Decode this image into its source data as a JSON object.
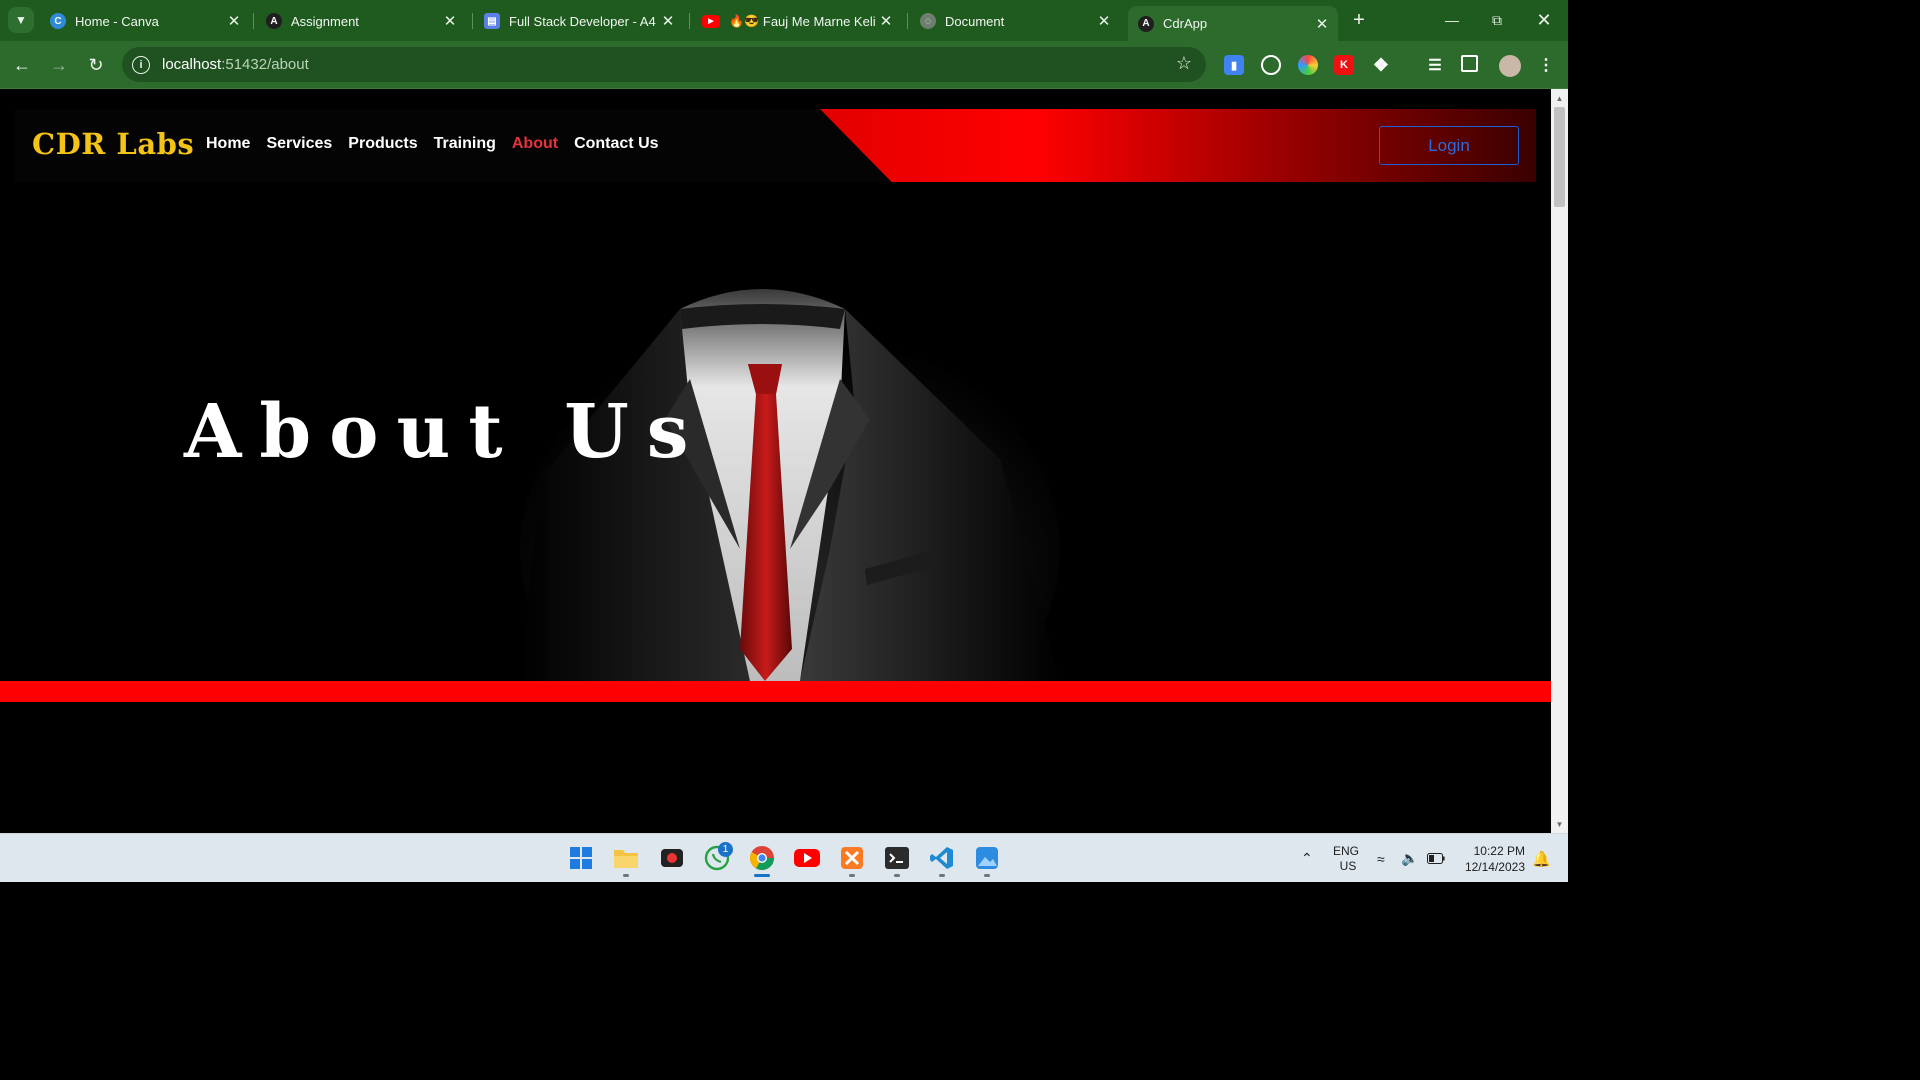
{
  "browser": {
    "tabs": [
      {
        "title": "Home - Canva",
        "icon": "canva-icon",
        "color": "#2f8bd8",
        "glyph": "C"
      },
      {
        "title": "Assignment",
        "icon": "angular-icon",
        "color": "#1f1f1f",
        "glyph": "A"
      },
      {
        "title": "Full Stack Developer - A4",
        "icon": "document-icon",
        "color": "#5b7fe6",
        "glyph": "▤"
      },
      {
        "title": "Fauj Me Marne Keliye",
        "icon": "youtube-icon",
        "color": "#ff0000",
        "glyph": "▶"
      },
      {
        "title": "Document",
        "icon": "globe-icon",
        "color": "#6f7f6f",
        "glyph": "◌"
      },
      {
        "title": "CdrApp",
        "icon": "angular-icon",
        "color": "#1f1f1f",
        "glyph": "A"
      }
    ],
    "url_host": "localhost",
    "url_path": ":51432/about"
  },
  "site": {
    "logo": "CDR Labs",
    "menu": [
      "Home",
      "Services",
      "Products",
      "Training",
      "About",
      "Contact Us"
    ],
    "active_menu": "About",
    "login_label": "Login",
    "hero_title": "About Us",
    "colors": {
      "accent_red": "#ff0000",
      "logo_yellow": "#f3c316",
      "login_blue": "#2a6be0",
      "active_link": "#e3343c"
    }
  },
  "taskbar": {
    "apps": [
      "windows-start-icon",
      "file-explorer-icon",
      "screen-recorder-icon",
      "whatsapp-icon",
      "chrome-icon",
      "youtube-icon",
      "xampp-icon",
      "terminal-icon",
      "vscode-icon",
      "photos-icon"
    ],
    "whatsapp_badge": "1",
    "language": "ENG",
    "region": "US",
    "time": "10:22 PM",
    "date": "12/14/2023"
  }
}
